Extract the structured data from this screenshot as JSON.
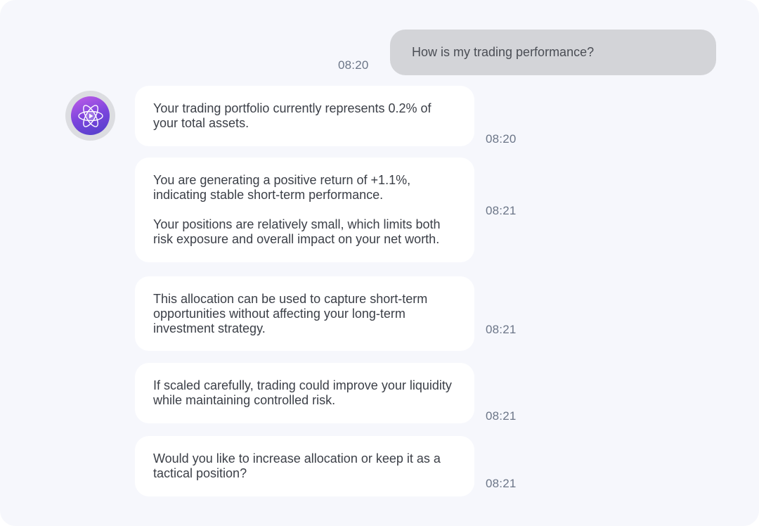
{
  "user_message": {
    "text": "How is my trading performance?",
    "time": "08:20"
  },
  "assistant": {
    "avatar_icon": "atom-play-icon",
    "messages": [
      {
        "paragraphs": [
          "Your trading portfolio currently represents 0.2% of your total assets."
        ],
        "time": "08:20"
      },
      {
        "paragraphs": [
          "You are generating a positive return of +1.1%, indicating stable short-term performance.",
          "Your positions are relatively small, which limits both risk exposure and overall impact on your net worth."
        ],
        "time": "08:21"
      },
      {
        "paragraphs": [
          "This allocation can be used to capture short-term opportunities without affecting your long-term investment strategy."
        ],
        "time": "08:21"
      },
      {
        "paragraphs": [
          "If scaled carefully, trading could improve your liquidity while maintaining controlled risk."
        ],
        "time": "08:21"
      },
      {
        "paragraphs": [
          "Would you like to increase allocation or keep it as a tactical position?"
        ],
        "time": "08:21"
      }
    ]
  },
  "colors": {
    "background": "#f6f7fc",
    "user_bubble": "#d3d4d8",
    "assistant_bubble": "#ffffff",
    "timestamp": "#6c7688",
    "avatar_gradient_start": "#c15ee8",
    "avatar_gradient_end": "#4f3fc9"
  }
}
